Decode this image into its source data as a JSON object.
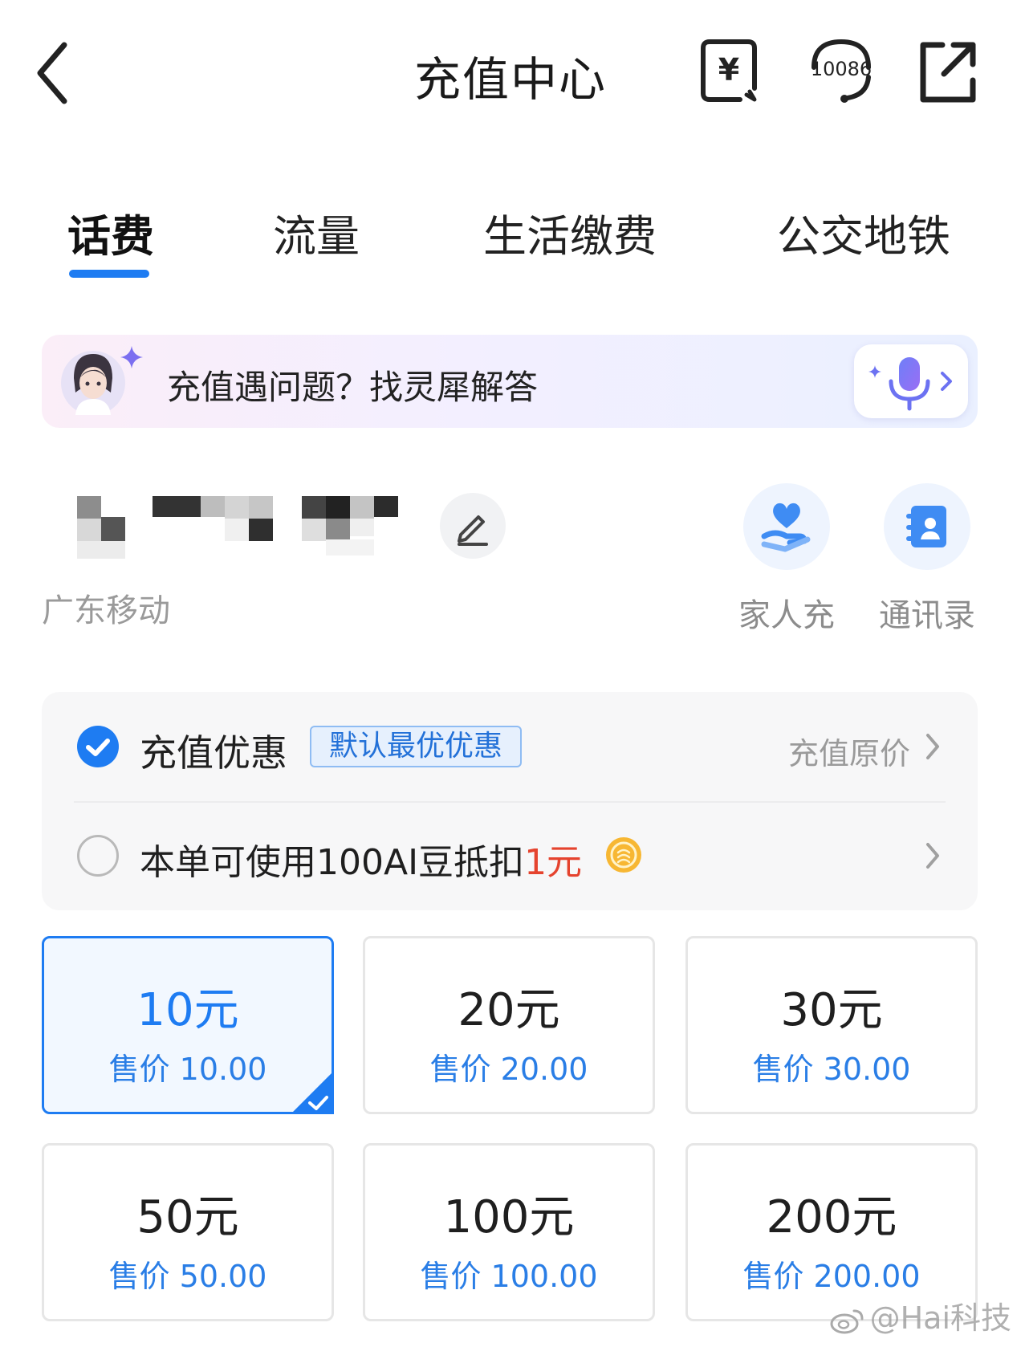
{
  "header": {
    "title": "充值中心",
    "service_icon_text": "10086",
    "bill_icon_text": "¥"
  },
  "tabs": [
    {
      "label": "话费",
      "active": true
    },
    {
      "label": "流量",
      "active": false
    },
    {
      "label": "生活缴费",
      "active": false
    },
    {
      "label": "公交地铁",
      "active": false
    }
  ],
  "ai_banner": {
    "text": "充值遇问题？找灵犀解答"
  },
  "account": {
    "carrier": "广东移动",
    "quick_actions": [
      {
        "label": "家人充",
        "icon": "family-heart-icon"
      },
      {
        "label": "通讯录",
        "icon": "contacts-book-icon"
      }
    ]
  },
  "discount": {
    "option1": {
      "label": "充值优惠",
      "tag": "默认最优优惠",
      "right": "充值原价",
      "checked": true
    },
    "option2": {
      "prefix": "本单可使用100AI豆抵扣",
      "amount": "1元",
      "checked": false
    }
  },
  "amounts": [
    {
      "value": "10元",
      "price": "售价 10.00",
      "selected": true
    },
    {
      "value": "20元",
      "price": "售价 20.00",
      "selected": false
    },
    {
      "value": "30元",
      "price": "售价 30.00",
      "selected": false
    },
    {
      "value": "50元",
      "price": "售价 50.00",
      "selected": false
    },
    {
      "value": "100元",
      "price": "售价 100.00",
      "selected": false
    },
    {
      "value": "200元",
      "price": "售价 200.00",
      "selected": false
    }
  ],
  "watermark": "@Hai科技",
  "colors": {
    "accent": "#1e7cf2",
    "price_blue": "#2a7ee6",
    "highlight_red": "#e5432e",
    "muted_gray": "#9a9a9a"
  }
}
